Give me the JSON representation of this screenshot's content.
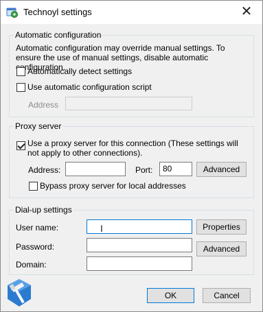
{
  "window": {
    "title": "Technoyl settings",
    "close_glyph": "✕"
  },
  "auto_config": {
    "group_label": "Automatic configuration",
    "description": "Automatic configuration may override manual settings.  To ensure the use of manual settings, disable automatic configuration.",
    "auto_detect": {
      "label": "Automatically detect settings",
      "checked": false
    },
    "use_script": {
      "label": "Use automatic configuration script",
      "checked": false
    },
    "address": {
      "label": "Address",
      "value": ""
    }
  },
  "proxy": {
    "group_label": "Proxy server",
    "use_proxy": {
      "label": "Use a proxy server for this connection (These settings will not apply to other connections).",
      "checked": true
    },
    "address": {
      "label": "Address:",
      "value": ""
    },
    "port": {
      "label": "Port:",
      "value": "80"
    },
    "advanced_label": "Advanced",
    "bypass": {
      "label": "Bypass proxy server for local addresses",
      "checked": false
    }
  },
  "dialup": {
    "group_label": "Dial-up settings",
    "username": {
      "label": "User name:",
      "value": ""
    },
    "password": {
      "label": "Password:",
      "value": ""
    },
    "domain": {
      "label": "Domain:",
      "value": ""
    },
    "properties_label": "Properties",
    "advanced_label": "Advanced"
  },
  "footer": {
    "ok_label": "OK",
    "cancel_label": "Cancel"
  },
  "icons": [
    "settings-window-icon",
    "close-icon",
    "hammer-logo-icon",
    "text-cursor-icon"
  ],
  "colors": {
    "accent": "#0078d7",
    "logo_blue": "#2b7bd1"
  }
}
